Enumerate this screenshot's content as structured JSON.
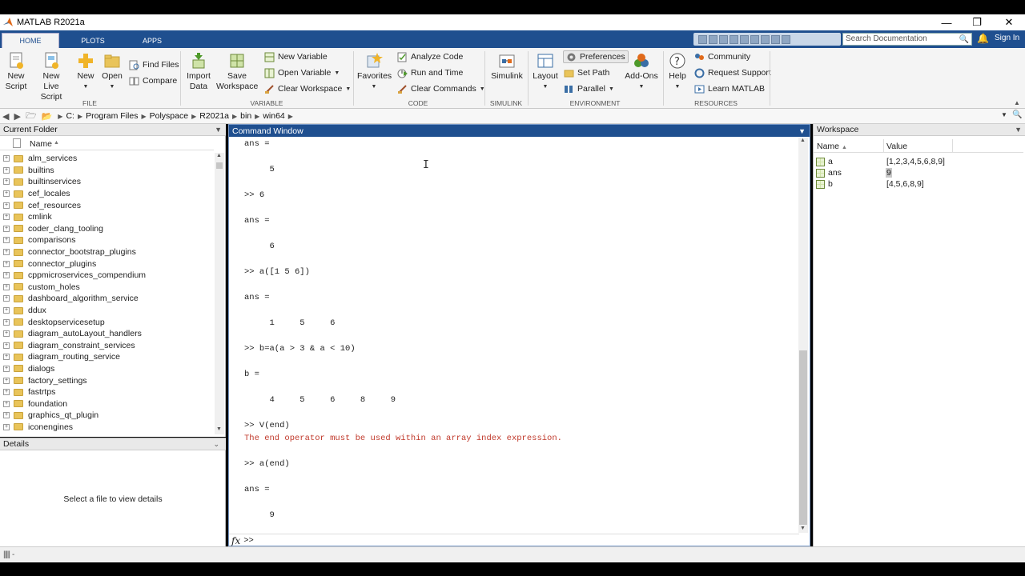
{
  "window": {
    "title": "MATLAB R2021a"
  },
  "tabs": [
    "HOME",
    "PLOTS",
    "APPS"
  ],
  "search": {
    "placeholder": "Search Documentation"
  },
  "account": {
    "signin": "Sign In"
  },
  "ribbon": {
    "file": {
      "label": "FILE",
      "new_script": [
        "New",
        "Script"
      ],
      "new_live_script": [
        "New",
        "Live Script"
      ],
      "new": "New",
      "open": "Open",
      "find_files": "Find Files",
      "compare": "Compare"
    },
    "variable": {
      "label": "VARIABLE",
      "import_data": [
        "Import",
        "Data"
      ],
      "save_workspace": [
        "Save",
        "Workspace"
      ],
      "new_variable": "New Variable",
      "open_variable": "Open Variable",
      "clear_workspace": "Clear Workspace"
    },
    "code": {
      "label": "CODE",
      "favorites": "Favorites",
      "analyze_code": "Analyze Code",
      "run_and_time": "Run and Time",
      "clear_commands": "Clear Commands"
    },
    "simulink": {
      "label": "SIMULINK",
      "simulink": "Simulink"
    },
    "environment": {
      "label": "ENVIRONMENT",
      "layout": "Layout",
      "preferences": "Preferences",
      "set_path": "Set Path",
      "parallel": "Parallel",
      "add_ons": "Add-Ons"
    },
    "resources": {
      "label": "RESOURCES",
      "help": "Help",
      "community": "Community",
      "request_support": "Request Support",
      "learn_matlab": "Learn MATLAB"
    }
  },
  "path": [
    "C:",
    "Program Files",
    "Polyspace",
    "R2021a",
    "bin",
    "win64"
  ],
  "current_folder": {
    "title": "Current Folder",
    "column": "Name",
    "items": [
      "alm_services",
      "builtins",
      "builtinservices",
      "cef_locales",
      "cef_resources",
      "cmlink",
      "coder_clang_tooling",
      "comparisons",
      "connector_bootstrap_plugins",
      "connector_plugins",
      "cppmicroservices_compendium",
      "custom_holes",
      "dashboard_algorithm_service",
      "ddux",
      "desktopservicesetup",
      "diagram_autoLayout_handlers",
      "diagram_constraint_services",
      "diagram_routing_service",
      "dialogs",
      "factory_settings",
      "fastrtps",
      "foundation",
      "graphics_qt_plugin",
      "iconengines"
    ]
  },
  "details": {
    "title": "Details",
    "empty_text": "Select a file to view details"
  },
  "command_window": {
    "title": "Command Window",
    "lines": [
      {
        "t": "ans =",
        "err": false
      },
      {
        "t": "",
        "err": false
      },
      {
        "t": "     5",
        "err": false
      },
      {
        "t": "",
        "err": false
      },
      {
        "t": ">> 6",
        "err": false
      },
      {
        "t": "",
        "err": false
      },
      {
        "t": "ans =",
        "err": false
      },
      {
        "t": "",
        "err": false
      },
      {
        "t": "     6",
        "err": false
      },
      {
        "t": "",
        "err": false
      },
      {
        "t": ">> a([1 5 6])",
        "err": false
      },
      {
        "t": "",
        "err": false
      },
      {
        "t": "ans =",
        "err": false
      },
      {
        "t": "",
        "err": false
      },
      {
        "t": "     1     5     6",
        "err": false
      },
      {
        "t": "",
        "err": false
      },
      {
        "t": ">> b=a(a > 3 & a < 10)",
        "err": false
      },
      {
        "t": "",
        "err": false
      },
      {
        "t": "b =",
        "err": false
      },
      {
        "t": "",
        "err": false
      },
      {
        "t": "     4     5     6     8     9",
        "err": false
      },
      {
        "t": "",
        "err": false
      },
      {
        "t": ">> V(end)",
        "err": false
      },
      {
        "t": "The end operator must be used within an array index expression.",
        "err": true
      },
      {
        "t": "",
        "err": false
      },
      {
        "t": ">> a(end)",
        "err": false
      },
      {
        "t": "",
        "err": false
      },
      {
        "t": "ans =",
        "err": false
      },
      {
        "t": "",
        "err": false
      },
      {
        "t": "     9",
        "err": false
      }
    ],
    "prompt": ">>",
    "fx": "fx"
  },
  "workspace": {
    "title": "Workspace",
    "columns": [
      "Name",
      "Value"
    ],
    "vars": [
      {
        "name": "a",
        "value": "[1,2,3,4,5,6,8,9]"
      },
      {
        "name": "ans",
        "value": "9"
      },
      {
        "name": "b",
        "value": "[4,5,6,8,9]"
      }
    ]
  }
}
